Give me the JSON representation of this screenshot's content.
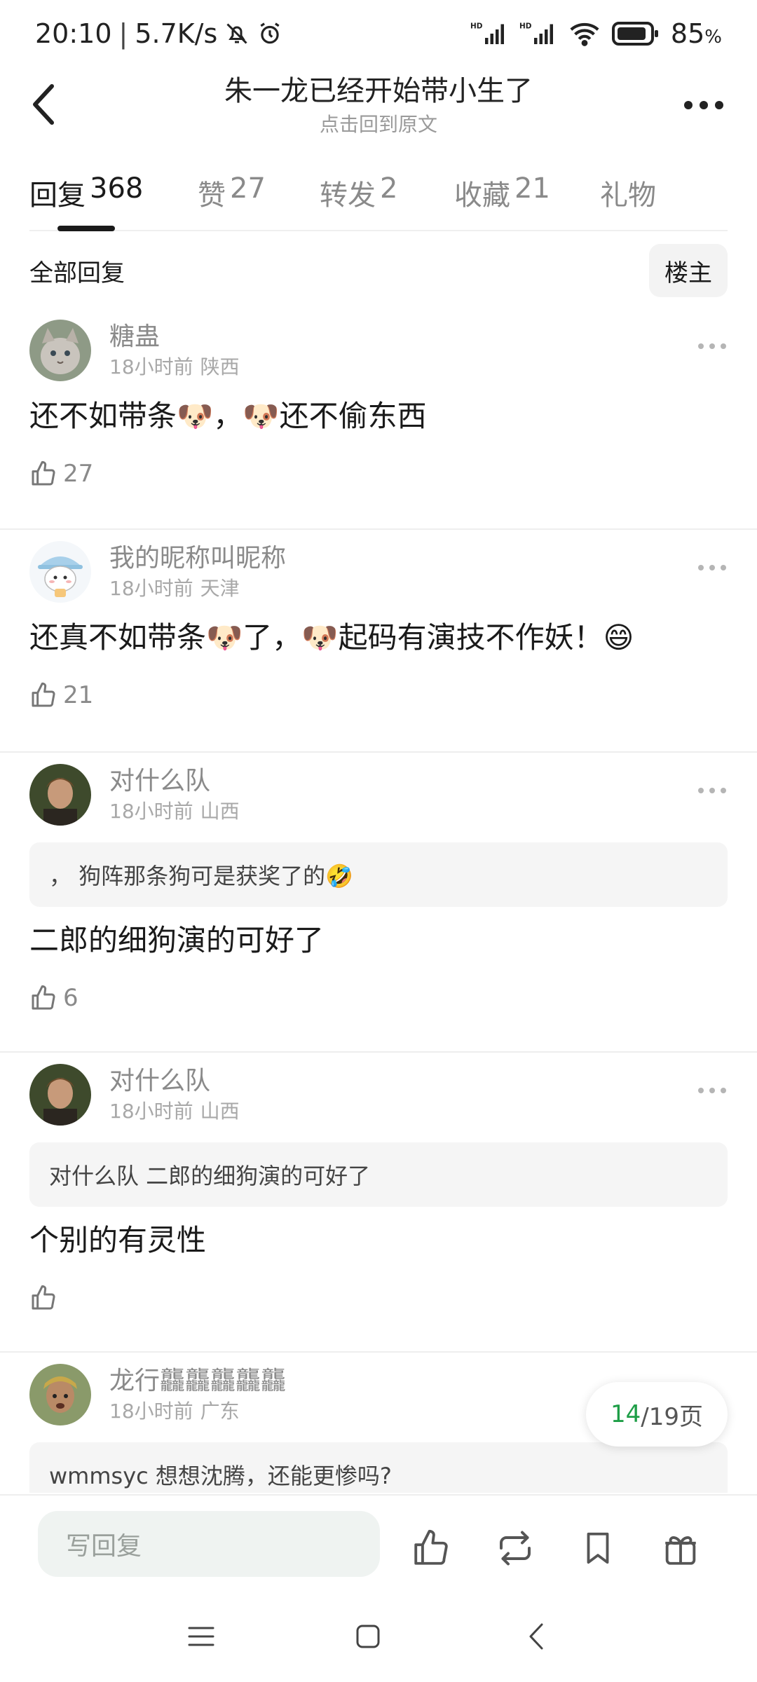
{
  "status_bar": {
    "time": "20:10",
    "net_speed": "5.7K/s",
    "battery": "85",
    "battery_unit": "%"
  },
  "header": {
    "title": "朱一龙已经开始带小生了",
    "subtitle": "点击回到原文"
  },
  "tabs": [
    {
      "label": "回复",
      "count": "368",
      "active": true
    },
    {
      "label": "赞",
      "count": "27"
    },
    {
      "label": "转发",
      "count": "2"
    },
    {
      "label": "收藏",
      "count": "21"
    },
    {
      "label": "礼物",
      "count": ""
    }
  ],
  "filter": {
    "label": "全部回复",
    "owner_button": "楼主"
  },
  "comments": [
    {
      "name": "糖蛊",
      "time": "18小时前",
      "location": "陕西",
      "text": "还不如带条🐶，🐶还不偷东西",
      "likes": "27"
    },
    {
      "name": "我的昵称叫昵称",
      "time": "18小时前",
      "location": "天津",
      "text": "还真不如带条🐶了，🐶起码有演技不作妖！😄",
      "likes": "21"
    },
    {
      "name": "对什么队",
      "time": "18小时前",
      "location": "山西",
      "quote": "，  狗阵那条狗可是获奖了的🤣",
      "text": "二郎的细狗演的可好了",
      "likes": "6"
    },
    {
      "name": "对什么队",
      "time": "18小时前",
      "location": "山西",
      "quote": "对什么队 二郎的细狗演的可好了",
      "text": "个别的有灵性",
      "likes": ""
    },
    {
      "name": "龙行龘龘龘龘龘",
      "time": "18小时前",
      "location": "广东",
      "quote": "wmmsyc 想想沈腾，还能更惨吗?"
    }
  ],
  "page_indicator": {
    "current": "14",
    "total": "/19页"
  },
  "bottom_bar": {
    "reply_placeholder": "写回复"
  },
  "colors": {
    "accent_green": "#1e9e47",
    "input_bg": "#eff3f1"
  }
}
